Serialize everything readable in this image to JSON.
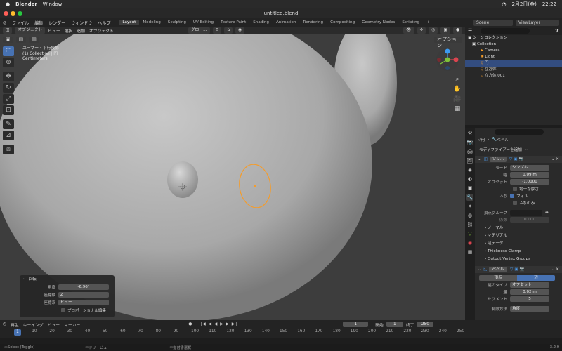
{
  "macbar": {
    "app": "Blender",
    "menu": "Window",
    "date": "2月2日(金)",
    "time": "22:22"
  },
  "window": {
    "title": "untitled.blend"
  },
  "menu": [
    "ファイル",
    "編集",
    "レンダー",
    "ウィンドウ",
    "ヘルプ"
  ],
  "workspaces": [
    "Layout",
    "Modeling",
    "Sculpting",
    "UV Editing",
    "Texture Paint",
    "Shading",
    "Animation",
    "Rendering",
    "Compositing",
    "Geometry Nodes",
    "Scripting"
  ],
  "scene": "Scene",
  "viewlayer": "ViewLayer",
  "viewport": {
    "mode": "オブジェクト",
    "view": "ビュー",
    "select": "選択",
    "add": "追加",
    "object": "オブジェクト",
    "transform": "グロー...",
    "options": "オプション",
    "info1": "ユーザー・平行投影",
    "info2": "(1) Collection | 円",
    "info3": "Centimeters"
  },
  "operator": {
    "title": "回転",
    "angle_label": "角度",
    "angle": "-6.96°",
    "axis_label": "座標軸",
    "axis": "Z",
    "orient_label": "座標系",
    "orient": "ビュー",
    "prop_edit": "プロポーショナル編集"
  },
  "outliner": {
    "root": "シーンコレクション",
    "collection": "Collection",
    "items": [
      "Camera",
      "Light",
      "円",
      "立方体",
      "立方体.001"
    ]
  },
  "props": {
    "object": "円",
    "modifier": "ベベル",
    "add_modifier": "モディファイアーを追加",
    "solidify_name": "ソリ...",
    "mode_label": "モード",
    "mode": "シンプル",
    "thickness_label": "幅",
    "thickness": "0.09 m",
    "offset_label": "オフセット",
    "offset": "-1.0000",
    "even": "均一な厚さ",
    "rim_label": "ふち",
    "fill": "フィル",
    "rim_only": "ふちのみ",
    "vgroup": "頂点グループ",
    "factor_label": "係数",
    "factor": "0.000",
    "normals": "ノーマル",
    "materials": "マテリアル",
    "edge_data": "辺データ",
    "thickness_clamp": "Thickness Clamp",
    "output_vg": "Output Vertex Groups",
    "bevel_name": "ベベル",
    "vertices": "頂点",
    "edges": "辺",
    "width_type_label": "幅のタイプ",
    "width_type": "オフセット",
    "amount_label": "量",
    "amount": "0.02 m",
    "segments_label": "セグメント",
    "segments": "5",
    "limit_label": "制限方法",
    "limit": "角度"
  },
  "timeline": {
    "play": "再生",
    "keying": "キーイング",
    "view": "ビュー",
    "marker": "マーカー",
    "current": "1",
    "start_label": "開始",
    "start": "1",
    "end_label": "終了",
    "end": "250",
    "ticks": [
      "0",
      "10",
      "20",
      "30",
      "40",
      "50",
      "60",
      "70",
      "80",
      "90",
      "100",
      "110",
      "120",
      "130",
      "140",
      "150",
      "160",
      "170",
      "180",
      "190",
      "200",
      "210",
      "220",
      "230",
      "240",
      "250"
    ],
    "frame": "1"
  },
  "status": {
    "select": "Select (Toggle)",
    "dolly": "ドリービュー",
    "menu": "指付書選択",
    "version": "3.2.0"
  }
}
